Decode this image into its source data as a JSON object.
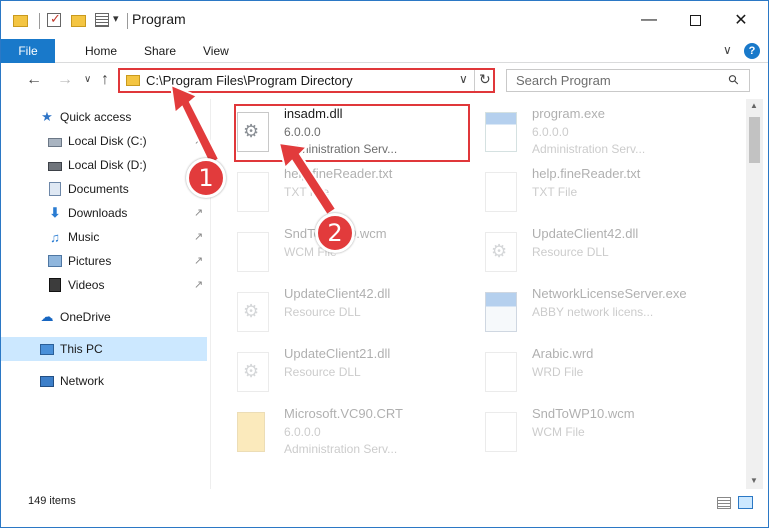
{
  "window": {
    "title": "Program",
    "controls": {
      "minimize": "—",
      "close": "✕"
    }
  },
  "quick_access_toolbar": {
    "dropdown_glyph": "▾"
  },
  "ribbon": {
    "tabs": [
      "File",
      "Home",
      "Share",
      "View"
    ],
    "expand_glyph": "∨",
    "help_glyph": "?"
  },
  "navigation_bar": {
    "back_glyph": "←",
    "forward_glyph": "→",
    "recent_glyph": "∨",
    "up_glyph": "↑",
    "address": "C:\\Program Files\\Program Directory",
    "address_chevron": "∨",
    "refresh_glyph": "↻",
    "search_placeholder": "Search Program",
    "search_glyph": "⚲"
  },
  "navigation_pane": {
    "items": [
      {
        "label": "Quick access",
        "icon": "star-icon",
        "pinned": false
      },
      {
        "label": "Local Disk (C:)",
        "icon": "disk-icon",
        "pinned": true
      },
      {
        "label": "Local Disk (D:)",
        "icon": "disk-icon",
        "pinned": false
      },
      {
        "label": "Documents",
        "icon": "documents-icon",
        "pinned": true
      },
      {
        "label": "Downloads",
        "icon": "download-icon",
        "pinned": true
      },
      {
        "label": "Music",
        "icon": "music-icon",
        "pinned": true
      },
      {
        "label": "Pictures",
        "icon": "pictures-icon",
        "pinned": true
      },
      {
        "label": "Videos",
        "icon": "videos-icon",
        "pinned": true
      },
      {
        "label": "OneDrive",
        "icon": "cloud-icon",
        "pinned": false
      },
      {
        "label": "This PC",
        "icon": "computer-icon",
        "pinned": false,
        "selected": true
      },
      {
        "label": "Network",
        "icon": "network-icon",
        "pinned": false
      }
    ],
    "pin_glyph": "↗"
  },
  "files": [
    {
      "name": "insadm.dll",
      "line2": "6.0.0.0",
      "line3": "Administration Serv...",
      "icon": "dll-icon",
      "highlighted": true
    },
    {
      "name": "program.exe",
      "line2": "6.0.0.0",
      "line3": "Administration Serv...",
      "icon": "exe-icon"
    },
    {
      "name": "help.fineReader.txt",
      "line2": "TXT File",
      "line3": "",
      "icon": "text-file-icon"
    },
    {
      "name": "help.fineReader.txt",
      "line2": "TXT File",
      "line3": "",
      "icon": "text-file-icon"
    },
    {
      "name": "SndToWP10.wcm",
      "line2": "WCM File",
      "line3": "",
      "icon": "file-icon"
    },
    {
      "name": "UpdateClient42.dll",
      "line2": "Resource DLL",
      "line3": "",
      "icon": "dll-icon"
    },
    {
      "name": "UpdateClient42.dll",
      "line2": "Resource DLL",
      "line3": "",
      "icon": "dll-icon"
    },
    {
      "name": "NetworkLicenseServer.exe",
      "line2": "ABBY network licens...",
      "line3": "",
      "icon": "app-icon"
    },
    {
      "name": "UpdateClient21.dll",
      "line2": "Resource DLL",
      "line3": "",
      "icon": "dll-icon"
    },
    {
      "name": "Arabic.wrd",
      "line2": "WRD File",
      "line3": "",
      "icon": "file-icon"
    },
    {
      "name": "Microsoft.VC90.CRT",
      "line2": "6.0.0.0",
      "line3": "Administration Serv...",
      "icon": "folder-icon"
    },
    {
      "name": "SndToWP10.wcm",
      "line2": "WCM File",
      "line3": "",
      "icon": "file-icon"
    }
  ],
  "status_bar": {
    "item_count": "149 items"
  },
  "annotations": {
    "step1": "1",
    "step2": "2"
  },
  "colors": {
    "accent": "#1979ca",
    "highlight_red": "#e0373a",
    "callout_red": "#e23b3c",
    "selection": "#cce8ff"
  }
}
